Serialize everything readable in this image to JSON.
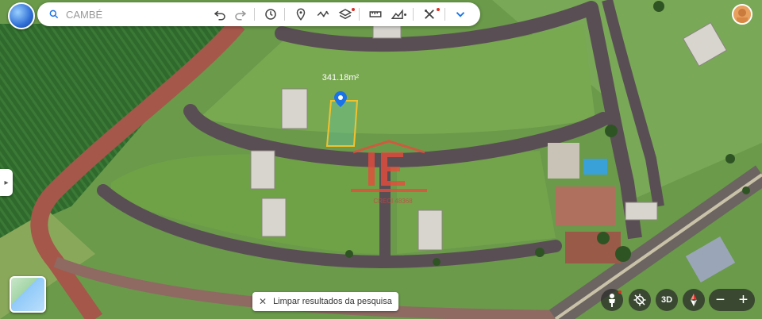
{
  "search": {
    "placeholder": "CAMBÉ"
  },
  "map": {
    "parcel_label": "341.18m²",
    "watermark_text": "CRECI 48368"
  },
  "toolbar": {
    "icons": [
      "undo-icon",
      "redo-icon",
      "history-icon",
      "pin-icon",
      "path-icon",
      "layers-icon",
      "ruler-icon",
      "chart-icon",
      "tools-icon",
      "chevron-down-icon"
    ]
  },
  "bottom": {
    "clear_label": "Limpar resultados da pesquisa",
    "three_d_label": "3D",
    "zoom_out_label": "−",
    "zoom_in_label": "+"
  },
  "colors": {
    "accent": "#1a73e8",
    "parcel": "#f2c12e"
  }
}
